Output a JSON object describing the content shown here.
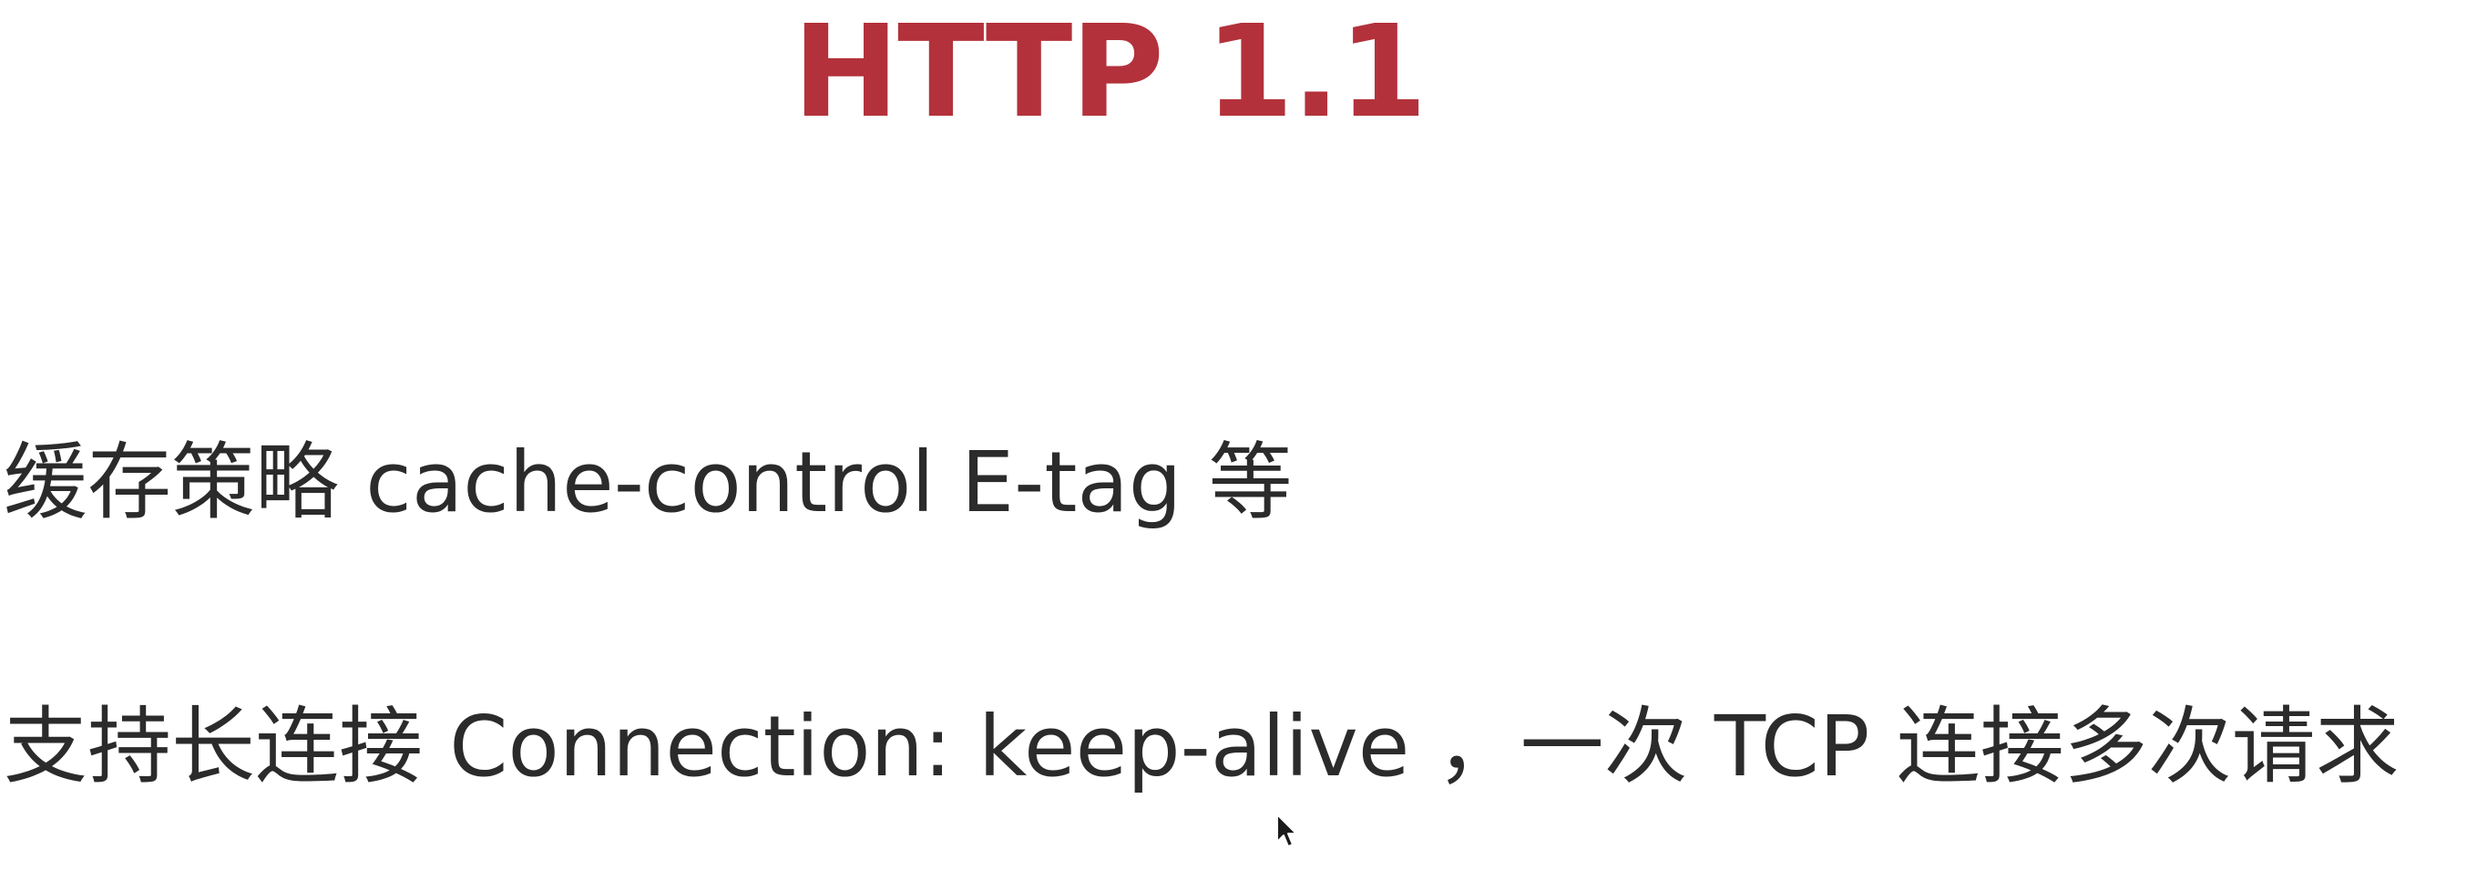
{
  "slide": {
    "title": "HTTP 1.1",
    "bullets": [
      {
        "text": "缓存策略 cache-control E-tag 等"
      },
      {
        "text": "支持长连接 Connection: keep-alive ，一次 TCP 连接多次请求"
      }
    ]
  },
  "colors": {
    "title": "#b3313b",
    "body_text": "#2b2b2b",
    "background": "#ffffff"
  },
  "icons": {
    "cursor": "mouse-pointer-icon"
  }
}
